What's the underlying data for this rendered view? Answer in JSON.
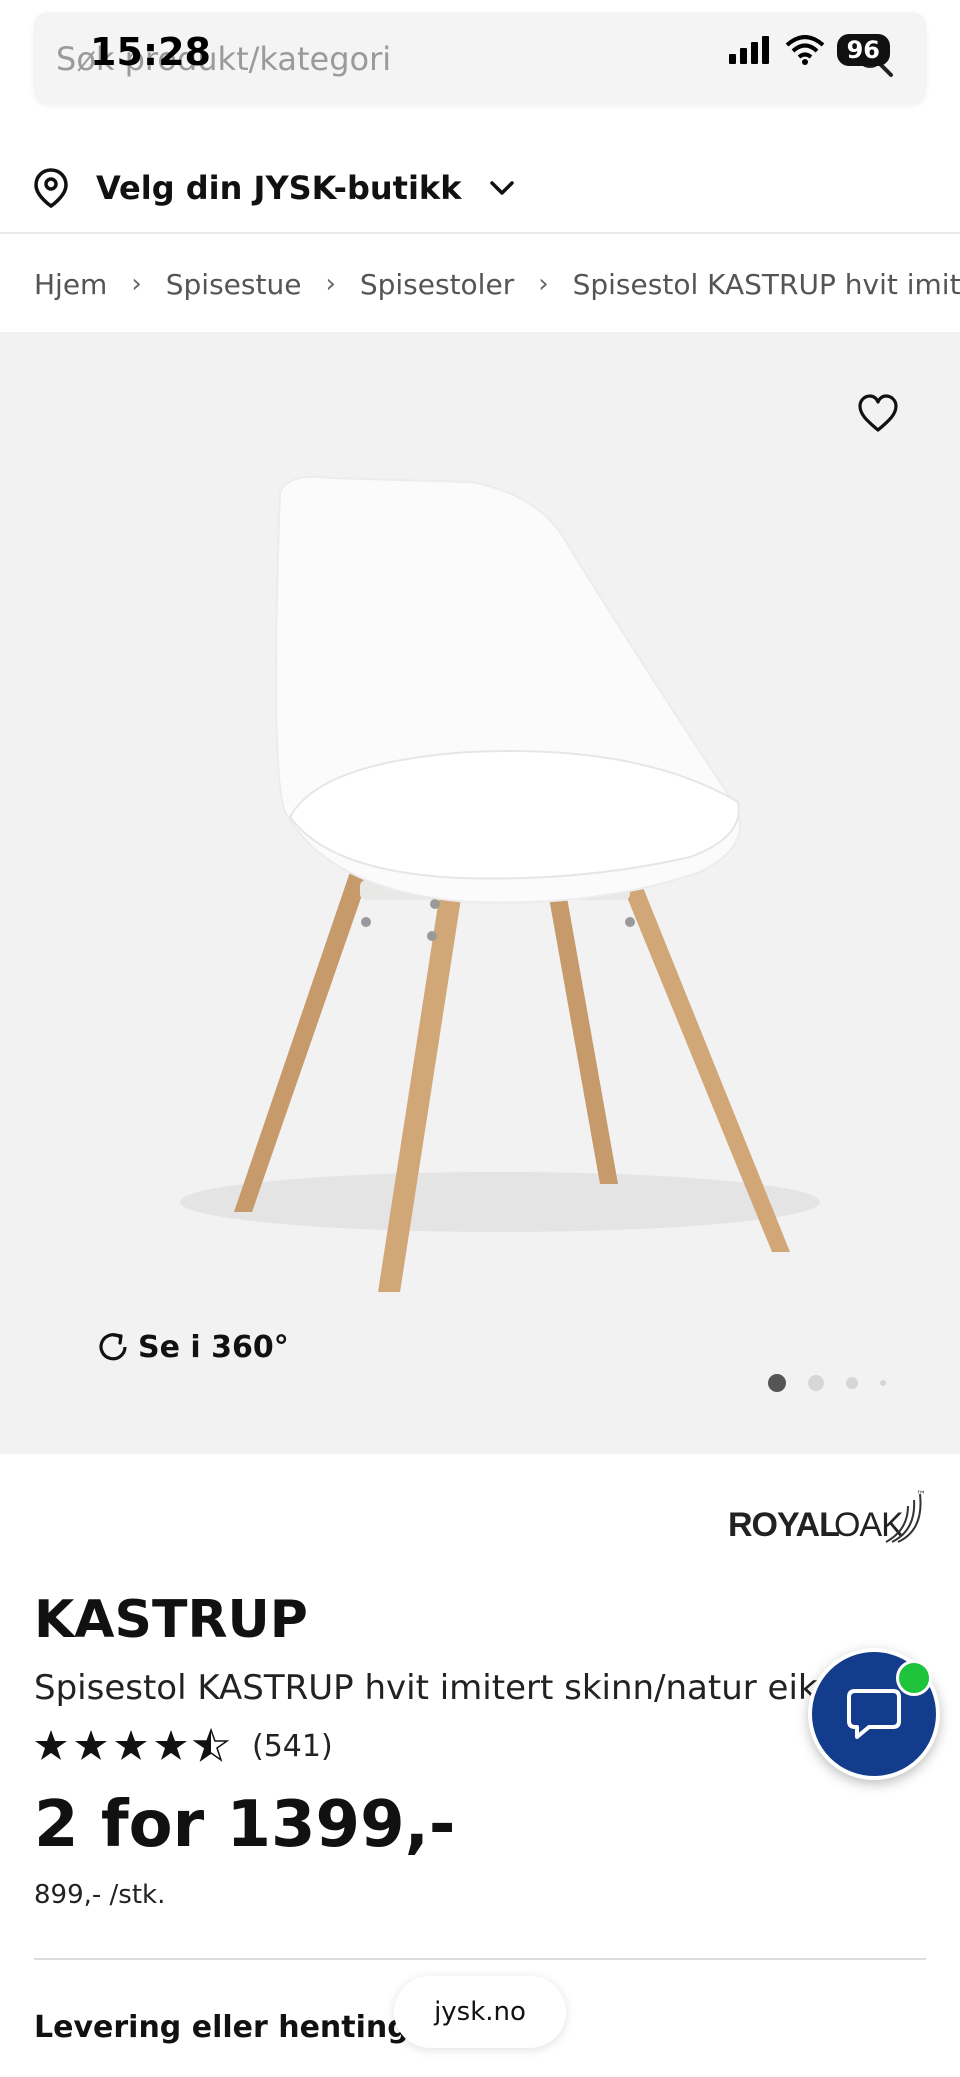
{
  "status_bar": {
    "time": "15:28",
    "battery": "96"
  },
  "search": {
    "placeholder": "Søk produkt/kategori"
  },
  "store": {
    "label": "Velg din JYSK-butikk"
  },
  "breadcrumb": [
    "Hjem",
    "Spisestue",
    "Spisestoler",
    "Spisestol KASTRUP hvit imitert ski"
  ],
  "gallery": {
    "view_360_label": "Se i 360°",
    "dot_count": 4,
    "active_dot": 0
  },
  "brand": {
    "name_bold": "ROYAL",
    "name_light": "OAK",
    "tm": "™"
  },
  "product": {
    "name": "KASTRUP",
    "description": "Spisestol KASTRUP hvit imitert skinn/natur eik",
    "rating": 4.5,
    "review_count": "(541)",
    "price": "2 for 1399,-",
    "unit_price": "899,- /stk."
  },
  "delivery": {
    "heading": "Levering eller henting?"
  },
  "browser": {
    "domain": "jysk.no"
  },
  "colors": {
    "chat_button": "#143c8c",
    "online": "#1ec43c",
    "image_bg": "#f2f2f2"
  }
}
